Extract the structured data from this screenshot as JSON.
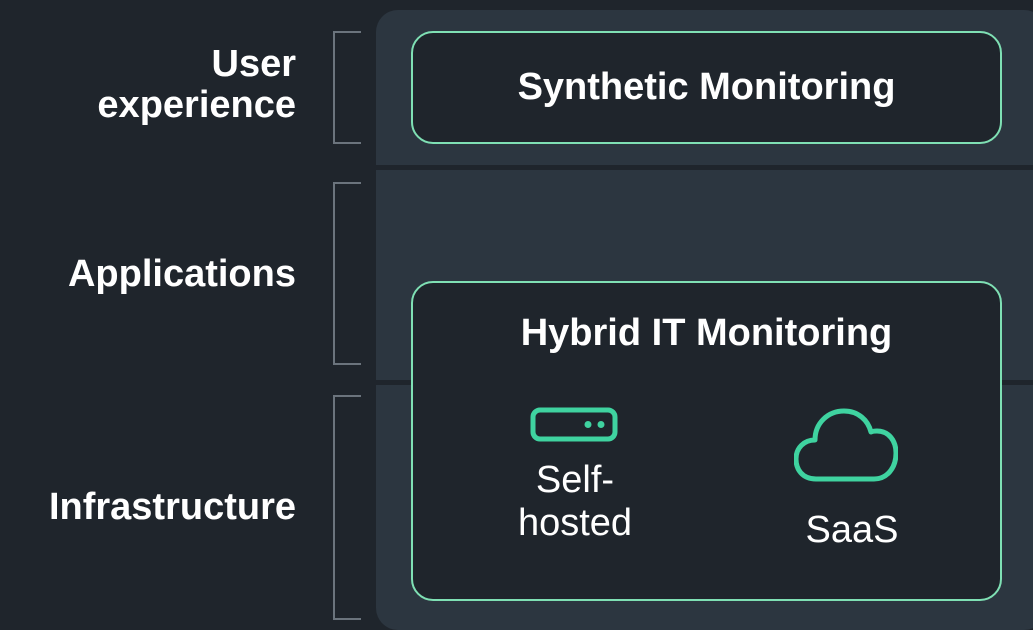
{
  "layers": [
    {
      "id": "ux",
      "label": "User\nexperience"
    },
    {
      "id": "apps",
      "label": "Applications"
    },
    {
      "id": "infra",
      "label": "Infrastructure"
    }
  ],
  "boxes": {
    "synthetic": {
      "title": "Synthetic Monitoring"
    },
    "hybrid": {
      "title": "Hybrid IT Monitoring",
      "items": [
        {
          "label": "Self-\nhosted",
          "icon": "server-icon"
        },
        {
          "label": "SaaS",
          "icon": "cloud-icon"
        }
      ]
    }
  },
  "colors": {
    "background": "#1f252c",
    "panel": "#2c3640",
    "accent": "#3fd3a0",
    "box_border": "#7fe0b4",
    "bracket": "#6b747d",
    "text": "#ffffff"
  }
}
